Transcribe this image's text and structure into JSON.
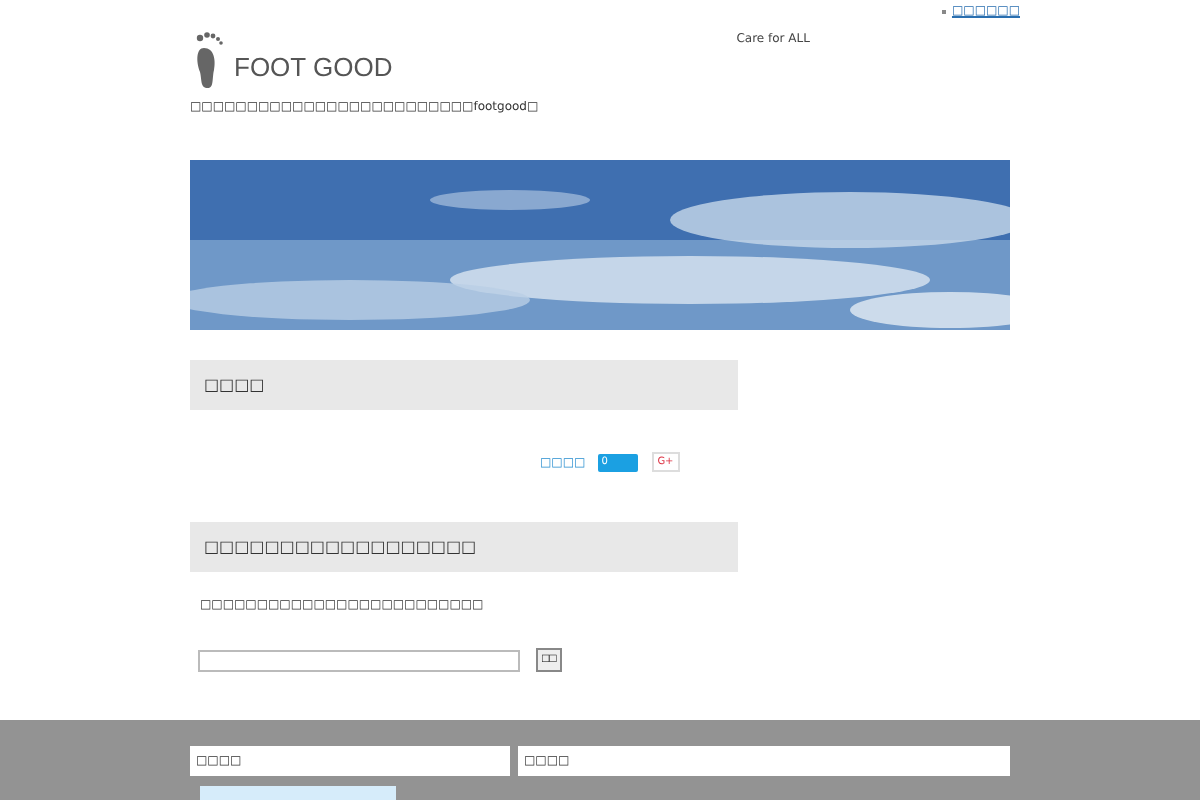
{
  "top_link": "□□□□□□",
  "header": {
    "logo": "FOOT GOOD",
    "slogan": "Care for ALL",
    "tagline": "□□□□□□□□□□□□□□□□□□□□□□□□□footgood□"
  },
  "sections": [
    {
      "heading": "□□□□",
      "share": {
        "label": "□□□□",
        "count": "0",
        "gplus": "G+"
      }
    },
    {
      "heading": "□□□□□□□□□□□□□□□□□□",
      "text": "□□□□□□□□□□□□□□□□□□□□□□□□□",
      "button": "□□"
    }
  ],
  "footer": {
    "fields": [
      "□□□□",
      "□□□□"
    ]
  }
}
